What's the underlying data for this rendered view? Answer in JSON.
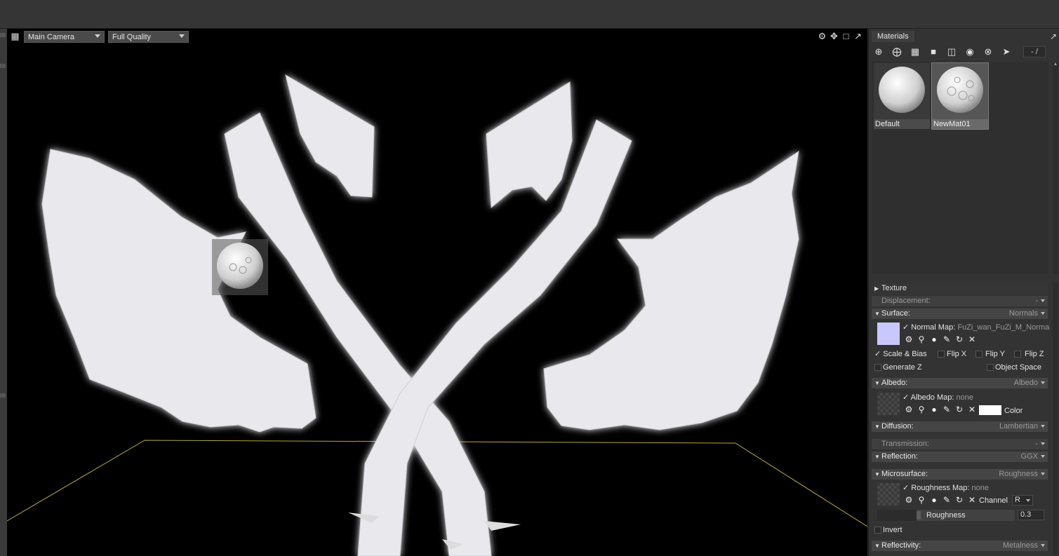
{
  "viewport": {
    "camera_select": "Main Camera",
    "quality_select": "Full Quality",
    "icons": [
      "camera-icon",
      "gear-icon",
      "move-icon",
      "frame-icon",
      "popout-icon"
    ]
  },
  "materials_panel": {
    "tab_title": "Materials",
    "counter": "- /",
    "toolbar_icons": [
      "add-icon",
      "duplicate-icon",
      "checker-icon",
      "folder-icon",
      "trash-icon",
      "select-icon",
      "close-icon",
      "next-icon"
    ],
    "materials": [
      {
        "name": "Default",
        "selected": false
      },
      {
        "name": "NewMat01",
        "selected": true
      }
    ]
  },
  "properties": {
    "texture": "Texture",
    "displacement": {
      "label": "Displacement:",
      "value": "-"
    },
    "surface": {
      "label": "Surface:",
      "value": "Normals",
      "map_label": "Normal Map:",
      "map_value": "FuZi_wan_FuZi_M_Normal",
      "swatch_color": "#c8c8ff",
      "options": [
        "Scale & Bias",
        "Flip X",
        "Flip Y",
        "Flip Z",
        "Generate Z",
        "Object Space"
      ]
    },
    "albedo": {
      "label": "Albedo:",
      "value": "Albedo",
      "map_label": "Albedo Map:",
      "map_value": "none",
      "color_label": "Color",
      "color_value": "#ffffff"
    },
    "diffusion": {
      "label": "Diffusion:",
      "value": "Lambertian"
    },
    "transmission": {
      "label": "Transmission:",
      "value": "-"
    },
    "reflection": {
      "label": "Reflection:",
      "value": "GGX"
    },
    "microsurface": {
      "label": "Microsurface:",
      "value": "Roughness",
      "map_label": "Roughness Map:",
      "map_value": "none",
      "channel_label": "Channel",
      "channel_value": "R",
      "slider_label": "Roughness",
      "slider_value": "0.3",
      "invert_label": "Invert"
    },
    "reflectivity": {
      "label": "Reflectivity:",
      "value": "Metalness"
    }
  }
}
